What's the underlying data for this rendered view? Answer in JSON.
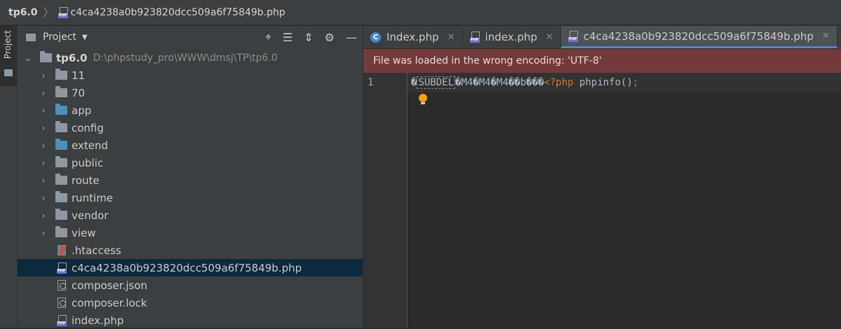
{
  "breadcrumb": {
    "root": "tp6.0",
    "separator": "〉",
    "file": "c4ca4238a0b923820dcc509a6f75849b.php"
  },
  "tool_strip": {
    "project_label": "Project"
  },
  "project_panel": {
    "title": "Project",
    "tools": [
      "target-icon",
      "expand-all-icon",
      "collapse-all-icon",
      "gear-icon",
      "minimize-icon"
    ],
    "root": {
      "name": "tp6.0",
      "path": "D:\\phpstudy_pro\\WWW\\dmsj\\TP\\tp6.0"
    },
    "folders": [
      {
        "name": "11",
        "color": "gray"
      },
      {
        "name": "70",
        "color": "gray"
      },
      {
        "name": "app",
        "color": "blue"
      },
      {
        "name": "config",
        "color": "gray"
      },
      {
        "name": "extend",
        "color": "blue"
      },
      {
        "name": "public",
        "color": "gray"
      },
      {
        "name": "route",
        "color": "gray"
      },
      {
        "name": "runtime",
        "color": "gray"
      },
      {
        "name": "vendor",
        "color": "gray"
      },
      {
        "name": "view",
        "color": "gray"
      }
    ],
    "files": [
      {
        "name": ".htaccess",
        "icon": "htaccess-icon"
      },
      {
        "name": "c4ca4238a0b923820dcc509a6f75849b.php",
        "icon": "php-file-icon",
        "selected": true
      },
      {
        "name": "composer.json",
        "icon": "json-file-icon"
      },
      {
        "name": "composer.lock",
        "icon": "json-file-icon"
      },
      {
        "name": "index.php",
        "icon": "php-file-icon"
      }
    ]
  },
  "tabs": [
    {
      "label": "Index.php",
      "icon": "class-icon",
      "active": false
    },
    {
      "label": "index.php",
      "icon": "php-file-icon",
      "active": false
    },
    {
      "label": "c4ca4238a0b923820dcc509a6f75849b.php",
      "icon": "php-file-icon",
      "active": true
    }
  ],
  "banner": {
    "message": "File was loaded in the wrong encoding: 'UTF-8'"
  },
  "editor": {
    "line_number": "1",
    "code": {
      "lead": "�",
      "subdel": "SUBDEL",
      "garbage": "�M4�M4�M4��b���",
      "php_open": "<?php",
      "call": " phpinfo()",
      "semicolon": ";"
    }
  },
  "colors": {
    "banner_bg": "#743a3a",
    "selection_bg": "#0d293e",
    "accent": "#4a88c7",
    "php_keyword": "#cc7832"
  }
}
